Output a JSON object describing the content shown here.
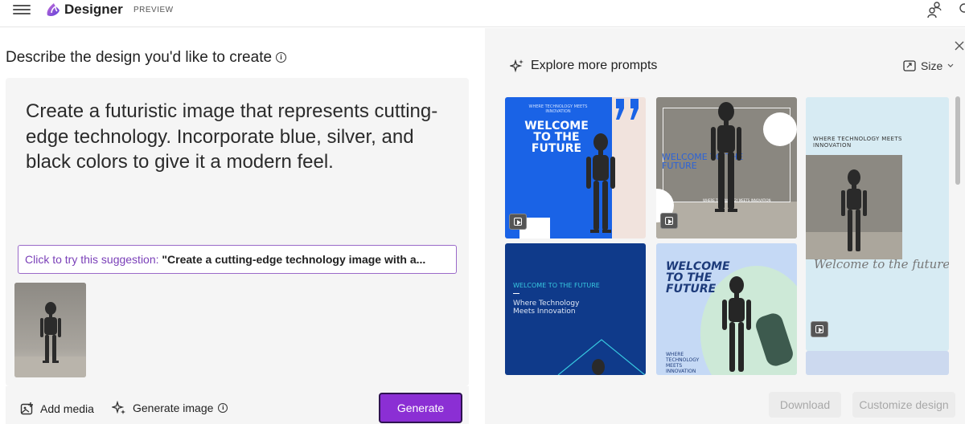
{
  "header": {
    "brand": "Designer",
    "badge": "PREVIEW"
  },
  "left_panel": {
    "title": "Describe the design you'd like to create",
    "prompt": "Create a futuristic image that represents cutting-edge technology. Incorporate blue, silver, and black colors to give it a modern feel.",
    "suggestion_lead": "Click to try this suggestion:",
    "suggestion_text": "\"Create a cutting-edge technology image with a...",
    "add_media_label": "Add media",
    "generate_image_label": "Generate image",
    "generate_button": "Generate"
  },
  "right_panel": {
    "explore_label": "Explore more prompts",
    "size_label": "Size",
    "download_button": "Download",
    "customize_button": "Customize design",
    "cards": [
      {
        "kicker": "WHERE TECHNOLOGY MEETS INNOVATION",
        "heading": "WELCOME TO THE FUTURE"
      },
      {
        "heading": "WELCOME TO THE FUTURE",
        "kicker": "WHERE TECHNOLOGY MEETS INNOVATION"
      },
      {
        "kicker": "WHERE TECHNOLOGY MEETS INNOVATION",
        "script": "Welcome to the future"
      },
      {
        "heading": "WELCOME TO THE FUTURE",
        "sub": "Where Technology Meets Innovation"
      },
      {
        "heading": "WELCOME TO THE FUTURE",
        "kicker": "WHERE TECHNOLOGY MEETS INNOVATION"
      }
    ]
  },
  "colors": {
    "accent": "#8b2fd4",
    "suggestion_border": "#9a6ac9",
    "card_blue": "#1a63e6",
    "card_navy": "#0f3a8a"
  }
}
